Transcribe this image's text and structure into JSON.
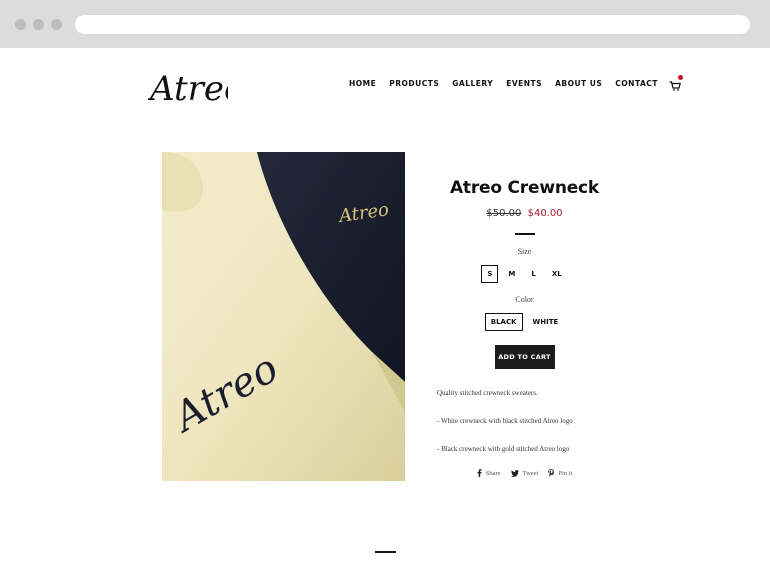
{
  "brand": {
    "logo_text": "Atreo"
  },
  "nav": {
    "items": [
      "HOME",
      "PRODUCTS",
      "GALLERY",
      "EVENTS",
      "ABOUT US",
      "CONTACT"
    ],
    "cart_icon": "cart-icon"
  },
  "product": {
    "title": "Atreo Crewneck",
    "compare_price": "$50.00",
    "price": "$40.00",
    "size_label": "Size",
    "sizes": [
      "S",
      "M",
      "L",
      "XL"
    ],
    "selected_size": "S",
    "color_label": "Color",
    "colors": [
      "BLACK",
      "WHITE"
    ],
    "selected_color": "BLACK",
    "add_to_cart": "ADD TO CART",
    "description": [
      "Quality stitched crewneck sweaters.",
      "- White crewneck with black stitched Atreo logo",
      "- Black crewneck with gold stitched Atreo logo"
    ],
    "photo_logo_text": "Atreo"
  },
  "share": {
    "share": "Share",
    "tweet": "Tweet",
    "pin": "Pin it"
  },
  "colors": {
    "sale": "#a71d2a",
    "button": "#1c1c1c",
    "chrome": "#dcdcdc"
  }
}
